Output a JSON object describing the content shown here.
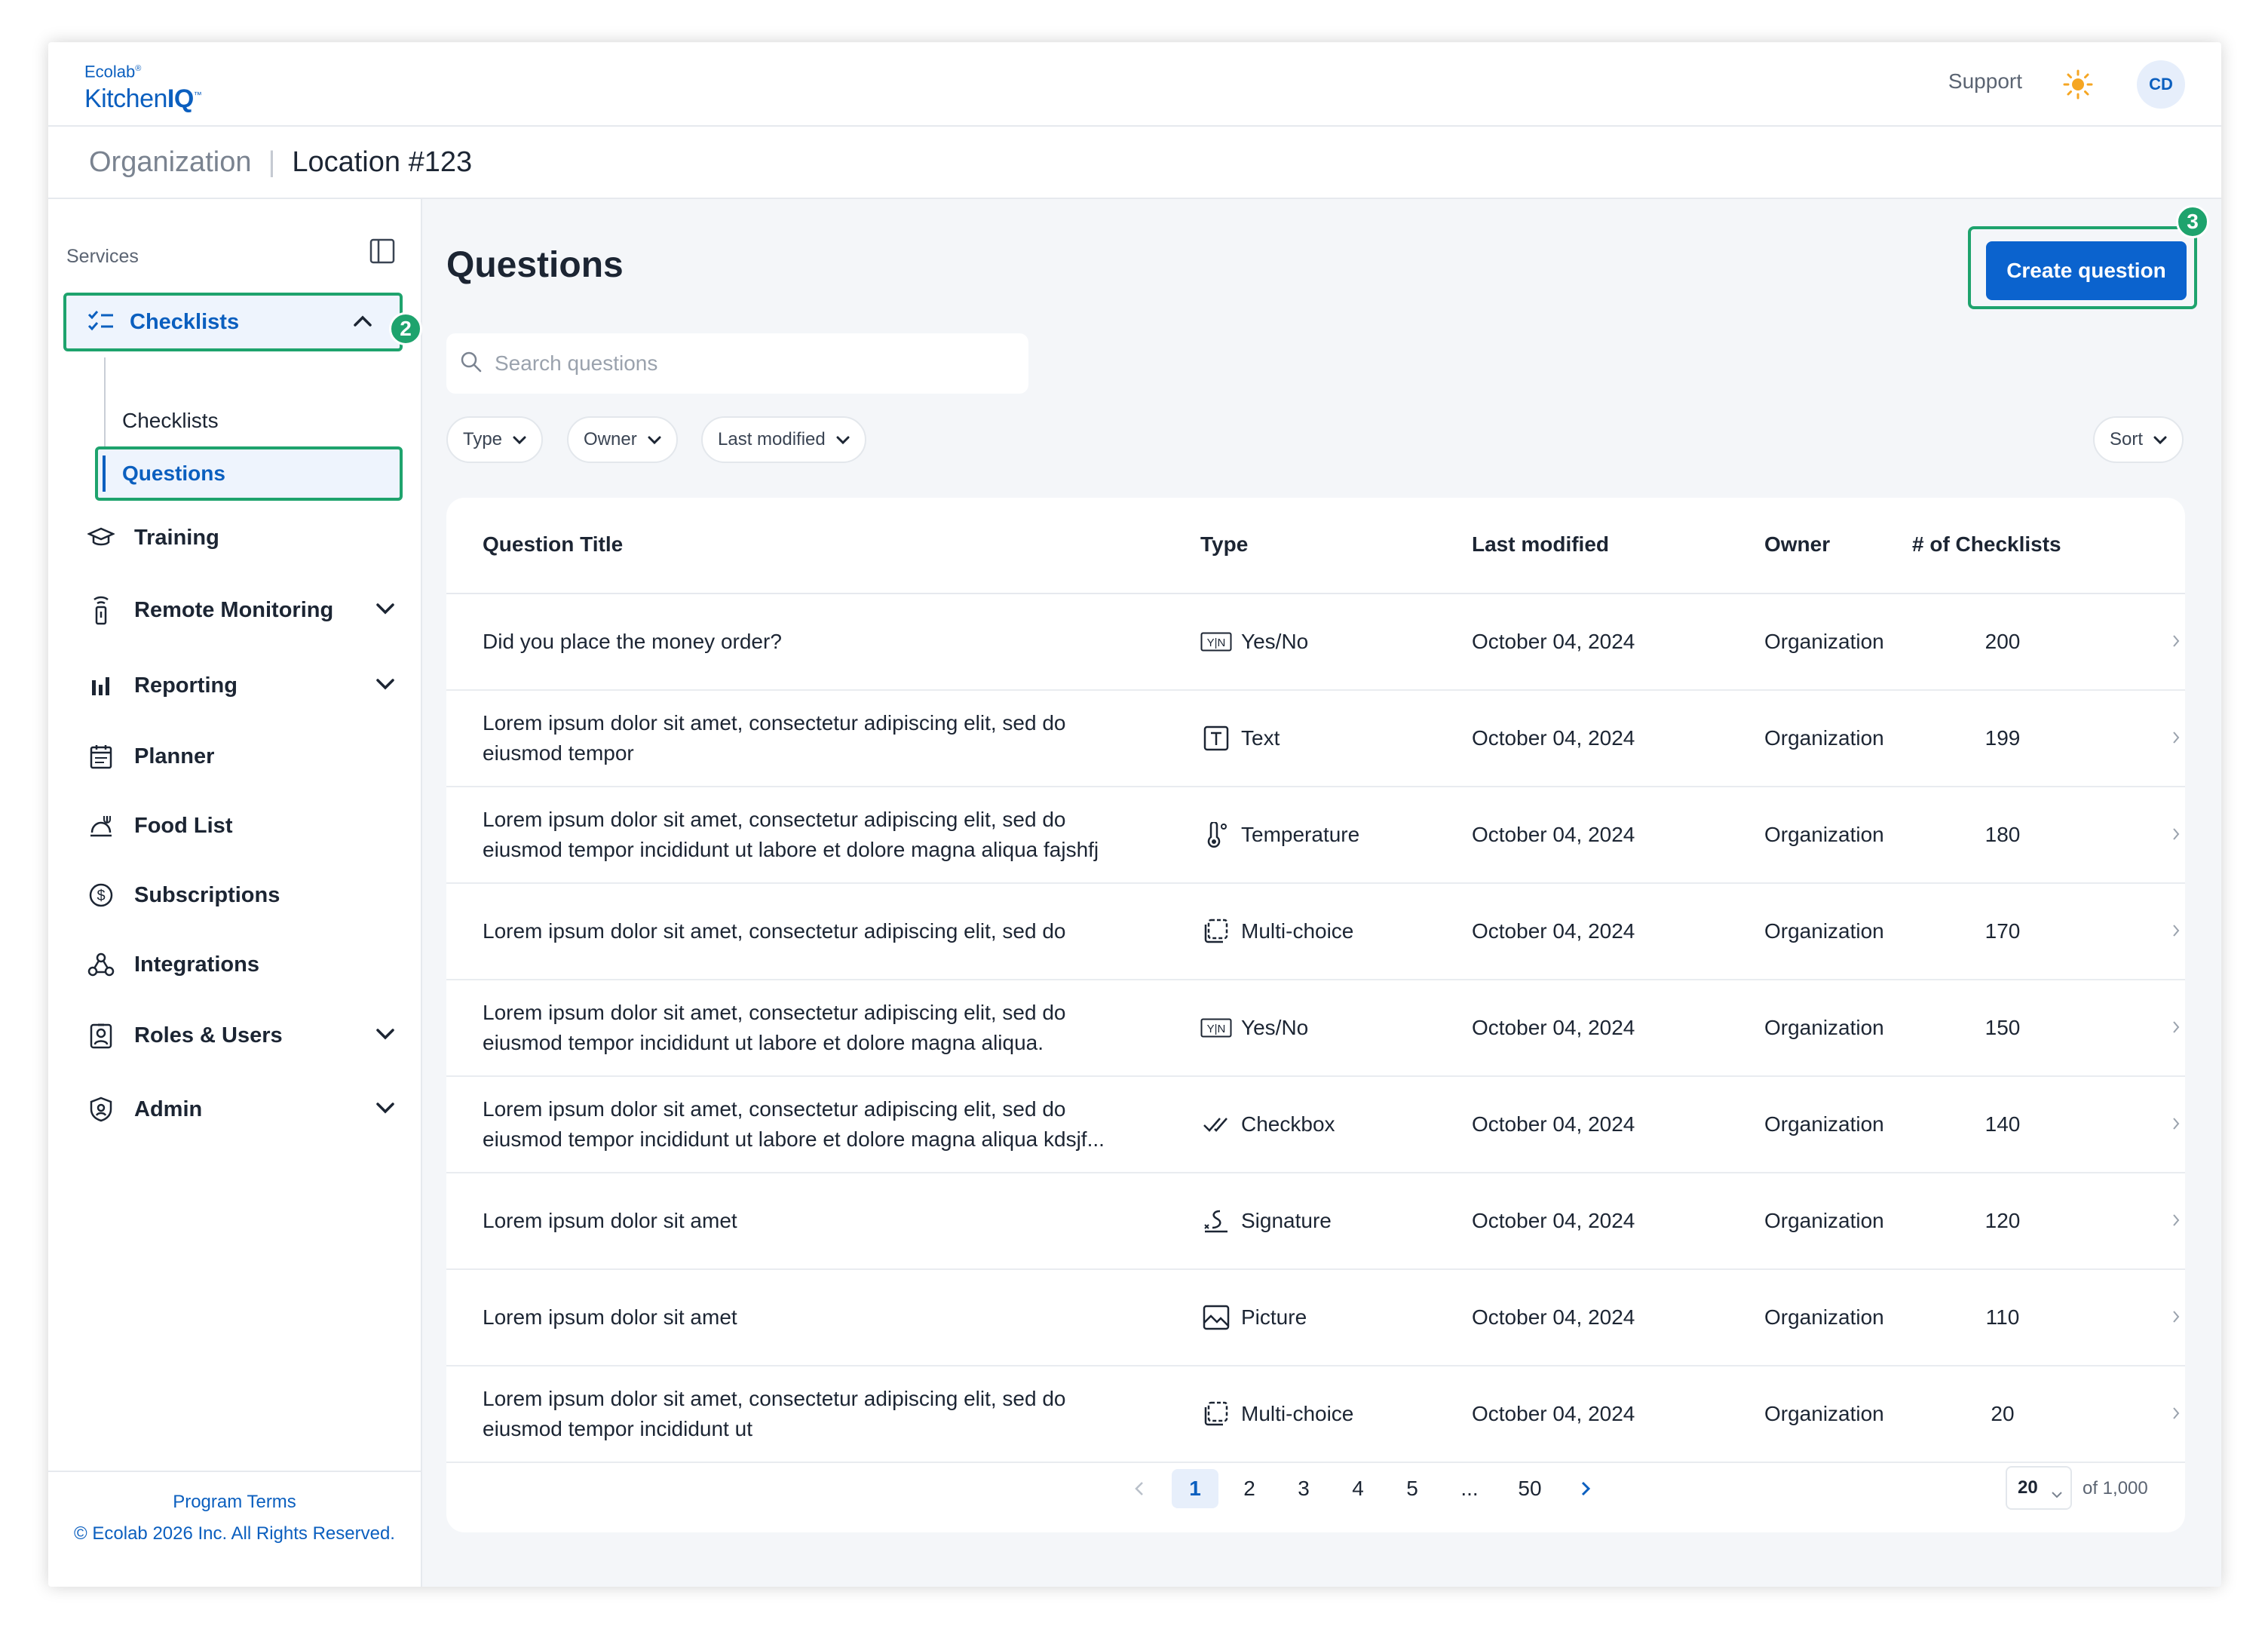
{
  "brand": {
    "line1": "Ecolab",
    "line2_prefix": "Kitchen",
    "line2_bold": "IQ",
    "tm": "™",
    "reg": "®"
  },
  "header": {
    "support": "Support",
    "avatar": "CD"
  },
  "breadcrumb": {
    "org": "Organization",
    "sep": "|",
    "location": "Location #123"
  },
  "sidebar": {
    "section_label": "Services",
    "checklists": {
      "label": "Checklists",
      "badge": "2"
    },
    "sub_items": [
      "Checklists",
      "Questions"
    ],
    "items": [
      {
        "label": "Training",
        "icon": "graduation-cap-icon",
        "chevron": false
      },
      {
        "label": "Remote Monitoring",
        "icon": "sensor-icon",
        "chevron": true
      },
      {
        "label": "Reporting",
        "icon": "bar-chart-icon",
        "chevron": true
      },
      {
        "label": "Planner",
        "icon": "calendar-icon",
        "chevron": false
      },
      {
        "label": "Food List",
        "icon": "food-tray-icon",
        "chevron": false
      },
      {
        "label": "Subscriptions",
        "icon": "dollar-circle-icon",
        "chevron": false
      },
      {
        "label": "Integrations",
        "icon": "webhook-icon",
        "chevron": false
      },
      {
        "label": "Roles & Users",
        "icon": "id-badge-icon",
        "chevron": true
      },
      {
        "label": "Admin",
        "icon": "shield-icon",
        "chevron": true
      }
    ],
    "footer": {
      "terms": "Program Terms",
      "copyright": "© Ecolab 2026 Inc. All Rights Reserved."
    }
  },
  "main": {
    "title": "Questions",
    "create_button": "Create question",
    "create_badge": "3",
    "search_placeholder": "Search questions",
    "filters": [
      "Type",
      "Owner",
      "Last modified"
    ],
    "sort": "Sort"
  },
  "table": {
    "columns": [
      "Question Title",
      "Type",
      "Last modified",
      "Owner",
      "# of Checklists"
    ],
    "rows": [
      {
        "title": "Did you place the money order?",
        "type": "Yes/No",
        "type_icon": "yes-no-icon",
        "modified": "October 04, 2024",
        "owner": "Organization",
        "count": "200"
      },
      {
        "title": "Lorem ipsum dolor sit amet, consectetur adipiscing elit, sed do eiusmod tempor",
        "type": "Text",
        "type_icon": "text-icon",
        "modified": "October 04, 2024",
        "owner": "Organization",
        "count": "199"
      },
      {
        "title": "Lorem ipsum dolor sit amet, consectetur adipiscing elit, sed do eiusmod tempor incididunt ut labore et dolore magna aliqua fajshfj",
        "type": "Temperature",
        "type_icon": "thermometer-icon",
        "modified": "October 04, 2024",
        "owner": "Organization",
        "count": "180"
      },
      {
        "title": "Lorem ipsum dolor sit amet, consectetur adipiscing elit, sed do",
        "type": "Multi-choice",
        "type_icon": "multi-choice-icon",
        "modified": "October 04, 2024",
        "owner": "Organization",
        "count": "170"
      },
      {
        "title": "Lorem ipsum dolor sit amet, consectetur adipiscing elit, sed do eiusmod tempor incididunt ut labore et dolore magna aliqua.",
        "type": "Yes/No",
        "type_icon": "yes-no-icon",
        "modified": "October 04, 2024",
        "owner": "Organization",
        "count": "150"
      },
      {
        "title": "Lorem ipsum dolor sit amet, consectetur adipiscing elit, sed do eiusmod tempor incididunt ut labore et dolore magna aliqua kdsjf...",
        "type": "Checkbox",
        "type_icon": "checkbox-icon",
        "modified": "October 04, 2024",
        "owner": "Organization",
        "count": "140"
      },
      {
        "title": "Lorem ipsum dolor sit amet",
        "type": "Signature",
        "type_icon": "signature-icon",
        "modified": "October 04, 2024",
        "owner": "Organization",
        "count": "120"
      },
      {
        "title": "Lorem ipsum dolor sit amet",
        "type": "Picture",
        "type_icon": "picture-icon",
        "modified": "October 04, 2024",
        "owner": "Organization",
        "count": "110"
      },
      {
        "title": "Lorem ipsum dolor sit amet, consectetur adipiscing elit, sed do eiusmod tempor incididunt ut",
        "type": "Multi-choice",
        "type_icon": "multi-choice-icon",
        "modified": "October 04, 2024",
        "owner": "Organization",
        "count": "20"
      }
    ]
  },
  "pagination": {
    "pages": [
      "1",
      "2",
      "3",
      "4",
      "5",
      "...",
      "50"
    ],
    "current": "1",
    "per_page": "20",
    "of_total": "of 1,000"
  },
  "colors": {
    "accent": "#0b63ce",
    "highlight": "#1ea36d",
    "text": "#1c2533"
  }
}
